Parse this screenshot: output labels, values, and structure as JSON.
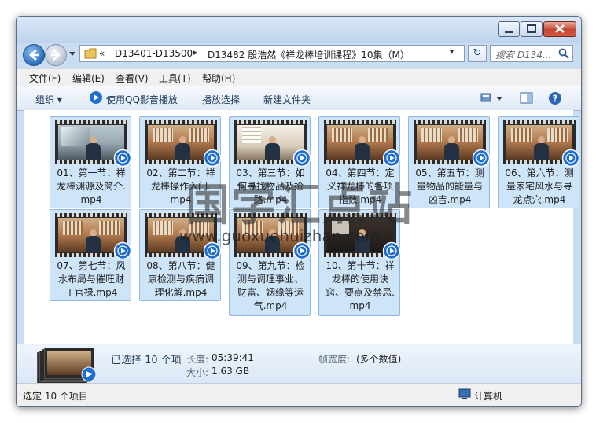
{
  "window": {
    "title_buttons": [
      "minimize",
      "maximize",
      "close"
    ]
  },
  "address_bar": {
    "chevron": "«",
    "segments": [
      "D13401-D13500",
      "D13482 殷浩然《祥龙棒培训课程》10集（M）"
    ],
    "dropdown_glyph": "▾"
  },
  "search": {
    "placeholder": "搜索 D134..."
  },
  "menu": {
    "items": [
      "文件(F)",
      "编辑(E)",
      "查看(V)",
      "工具(T)",
      "帮助(H)"
    ]
  },
  "toolbar": {
    "organize": "组织",
    "play_qq": "使用QQ影音播放",
    "play_selection": "播放选择",
    "new_folder": "新建文件夹"
  },
  "files": [
    {
      "name": "01、第一节：祥龙棒渊源及简介.mp4",
      "lines": [
        "01、第一节：祥",
        "龙棒渊源及简介.",
        "mp4"
      ],
      "thumb": "cool"
    },
    {
      "name": "02、第二节：祥龙棒操作入门.mp4",
      "lines": [
        "02、第二节：祥",
        "龙棒操作入门.",
        "mp4"
      ],
      "thumb": "warm"
    },
    {
      "name": "03、第三节：如何寻找物品及捡路.mp4",
      "lines": [
        "03、第三节：如",
        "何寻找物品及捡",
        "路.mp4"
      ],
      "thumb": "bright"
    },
    {
      "name": "04、第四节：定义祥龙棒的各项指数.mp4",
      "lines": [
        "04、第四节：定",
        "义祥龙棒的各项",
        "指数.mp4"
      ],
      "thumb": "warm"
    },
    {
      "name": "05、第五节：测量物品的能量与凶吉.mp4",
      "lines": [
        "05、第五节：测",
        "量物品的能量与",
        "凶吉.mp4"
      ],
      "thumb": "warm"
    },
    {
      "name": "06、第六节：测量家宅风水与寻龙点穴.mp4",
      "lines": [
        "06、第六节：测",
        "量家宅风水与寻",
        "龙点穴.mp4"
      ],
      "thumb": "warm"
    },
    {
      "name": "07、第七节：风水布局与催旺财丁官禄.mp4",
      "lines": [
        "07、第七节：风",
        "水布局与催旺财",
        "丁官禄.mp4"
      ],
      "thumb": "warm"
    },
    {
      "name": "08、第八节：健康检测与疾病调理化解.mp4",
      "lines": [
        "08、第八节：健",
        "康检测与疾病调",
        "理化解.mp4"
      ],
      "thumb": "warm"
    },
    {
      "name": "09、第九节：检测与调理事业、财富、姻缘等运气.mp4",
      "lines": [
        "09、第九节：检",
        "测与调理事业、",
        "财富、姻缘等运",
        "气.mp4"
      ],
      "thumb": "warm"
    },
    {
      "name": "10、第十节：祥龙棒的使用诀窍、要点及禁忌.mp4",
      "lines": [
        "10、第十节：祥",
        "龙棒的使用诀",
        "窍、要点及禁忌.",
        "mp4"
      ],
      "thumb": "dark"
    }
  ],
  "details": {
    "selected": "已选择 10 个项",
    "length_label": "长度:",
    "length_value": "05:39:41",
    "size_label": "大小:",
    "size_value": "1.63 GB",
    "width_label": "帧宽度:",
    "width_value": "(多个数值)"
  },
  "status": {
    "left": "选定 10 个项目",
    "right": "计算机"
  },
  "watermark": {
    "title": "国学汇点站",
    "url": "www.guoxuehuizhan.com"
  }
}
